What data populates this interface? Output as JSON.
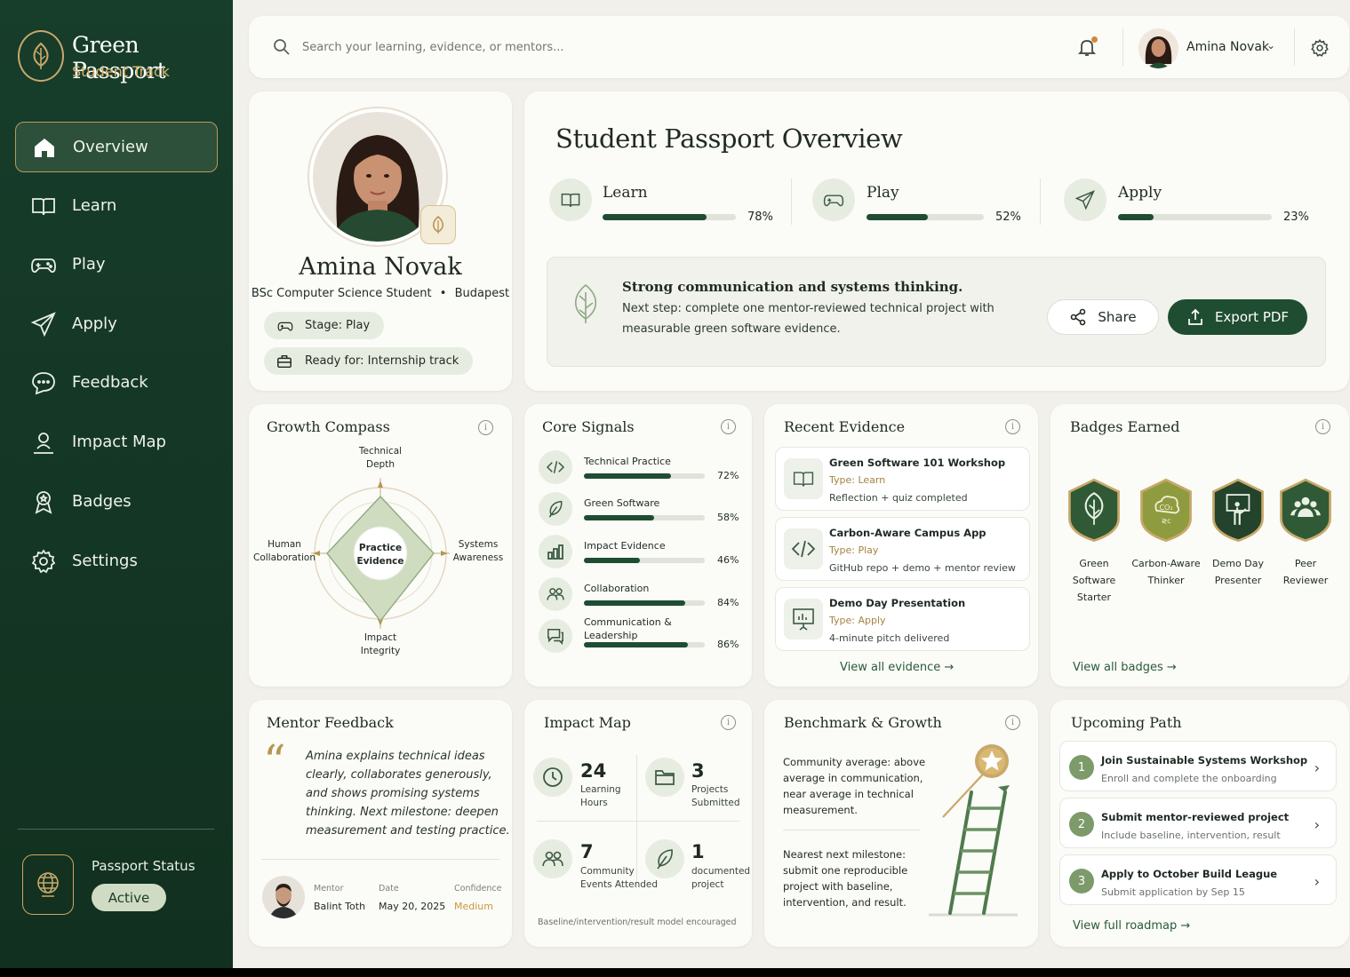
{
  "brand": {
    "title": "Green Passport",
    "subtitle": "Student Track"
  },
  "nav": [
    {
      "label": "Overview",
      "icon": "home-icon"
    },
    {
      "label": "Learn",
      "icon": "book-icon"
    },
    {
      "label": "Play",
      "icon": "gamepad-icon"
    },
    {
      "label": "Apply",
      "icon": "paper-plane-icon"
    },
    {
      "label": "Feedback",
      "icon": "chat-icon"
    },
    {
      "label": "Impact Map",
      "icon": "map-pin-person-icon"
    },
    {
      "label": "Badges",
      "icon": "ribbon-badge-icon"
    },
    {
      "label": "Settings",
      "icon": "gear-icon"
    }
  ],
  "passport_status": {
    "label": "Passport Status",
    "value": "Active"
  },
  "topbar": {
    "search_placeholder": "Search your learning, evidence, or mentors...",
    "user_name": "Amina Novak"
  },
  "profile": {
    "name": "Amina Novak",
    "program": "BSc Computer Science Student",
    "bullet": "•",
    "city": "Budapest",
    "stage": "Stage: Play",
    "ready": "Ready for: Internship track"
  },
  "overview": {
    "title": "Student Passport Overview",
    "progress": [
      {
        "label": "Learn",
        "value": 78,
        "text": "78%"
      },
      {
        "label": "Play",
        "value": 52,
        "text": "52%"
      },
      {
        "label": "Apply",
        "value": 23,
        "text": "23%"
      }
    ],
    "highlight": "Strong communication and systems thinking.",
    "next_step_1": "Next step: complete one mentor-reviewed technical project with",
    "next_step_2": "measurable green software evidence.",
    "share": "Share",
    "export": "Export PDF"
  },
  "growth_compass": {
    "title": "Growth Compass",
    "top_1": "Technical",
    "top_2": "Depth",
    "left_1": "Human",
    "left_2": "Collaboration",
    "right_1": "Systems",
    "right_2": "Awareness",
    "bottom_1": "Impact",
    "bottom_2": "Integrity",
    "center_1": "Practice",
    "center_2": "Evidence"
  },
  "core_signals": {
    "title": "Core Signals",
    "items": [
      {
        "label": "Technical Practice",
        "value": 72,
        "text": "72%",
        "icon": "code-icon"
      },
      {
        "label": "Green Software",
        "value": 58,
        "text": "58%",
        "icon": "leaf-icon"
      },
      {
        "label": "Impact Evidence",
        "value": 46,
        "text": "46%",
        "icon": "bar-chart-icon"
      },
      {
        "label": "Collaboration",
        "value": 84,
        "text": "84%",
        "icon": "people-icon"
      },
      {
        "label": "Communication &",
        "label2": "Leadership",
        "value": 86,
        "text": "86%",
        "icon": "speech-icon"
      }
    ]
  },
  "recent_evidence": {
    "title": "Recent Evidence",
    "items": [
      {
        "title": "Green Software 101 Workshop",
        "type": "Type: Learn",
        "desc": "Reflection + quiz completed",
        "icon": "book-icon"
      },
      {
        "title": "Carbon-Aware Campus App",
        "type": "Type: Play",
        "desc": "GitHub repo + demo + mentor review",
        "icon": "code-icon"
      },
      {
        "title": "Demo Day Presentation",
        "type": "Type: Apply",
        "desc": "4-minute pitch delivered",
        "icon": "presentation-icon"
      }
    ],
    "link": "View all evidence  →"
  },
  "badges": {
    "title": "Badges Earned",
    "items": [
      {
        "l1": "Green",
        "l2": "Software",
        "l3": "Starter",
        "color": "#2f5a35",
        "icon": "leaf-badge-icon"
      },
      {
        "l1": "Carbon-Aware",
        "l2": "Thinker",
        "l3": "",
        "color": "#8e9c3f",
        "icon": "co2-badge-icon"
      },
      {
        "l1": "Demo Day",
        "l2": "Presenter",
        "l3": "",
        "color": "#23432c",
        "icon": "presenter-badge-icon"
      },
      {
        "l1": "Peer",
        "l2": "Reviewer",
        "l3": "",
        "color": "#2f5a35",
        "icon": "peer-badge-icon"
      }
    ],
    "link": "View all badges  →"
  },
  "mentor_feedback": {
    "title": "Mentor Feedback",
    "quote_mark": "“",
    "lines": [
      "Amina explains technical ideas",
      "clearly, collaborates generously,",
      "and shows promising systems",
      "thinking. Next milestone: deepen",
      "measurement and testing practice."
    ],
    "mentor_label": "Mentor",
    "mentor_value": "Balint Toth",
    "date_label": "Date",
    "date_value": "May 20, 2025",
    "confidence_label": "Confidence",
    "confidence_value": "Medium"
  },
  "impact_map": {
    "title": "Impact Map",
    "stats": [
      {
        "num": "24",
        "l1": "Learning",
        "l2": "Hours",
        "icon": "clock-icon"
      },
      {
        "num": "3",
        "l1": "Projects",
        "l2": "Submitted",
        "icon": "folder-icon"
      },
      {
        "num": "7",
        "l1": "Community",
        "l2": "Events Attended",
        "icon": "people-icon"
      },
      {
        "num": "1",
        "l1": "documented",
        "l2": "project",
        "icon": "leaf-icon"
      }
    ],
    "footer": "Baseline/intervention/result model encouraged"
  },
  "benchmark": {
    "title": "Benchmark & Growth",
    "text1": [
      "Community average: above",
      "average in communication,",
      "near average in technical",
      "measurement."
    ],
    "text2": [
      "Nearest next milestone:",
      "submit one reproducible",
      "project with baseline,",
      "intervention, and result."
    ]
  },
  "upcoming": {
    "title": "Upcoming Path",
    "items": [
      {
        "n": "1",
        "title": "Join Sustainable Systems Workshop",
        "desc": "Enroll and complete the onboarding"
      },
      {
        "n": "2",
        "title": "Submit mentor-reviewed project",
        "desc": "Include baseline, intervention, result"
      },
      {
        "n": "3",
        "title": "Apply to October Build League",
        "desc": "Submit application by Sep 15"
      }
    ],
    "link": "View full roadmap  →"
  },
  "colors": {
    "sidebar": "#173d2b",
    "accent_gold": "#c9a86a",
    "primary_green": "#1f4d31",
    "background": "#f1f0ea"
  }
}
